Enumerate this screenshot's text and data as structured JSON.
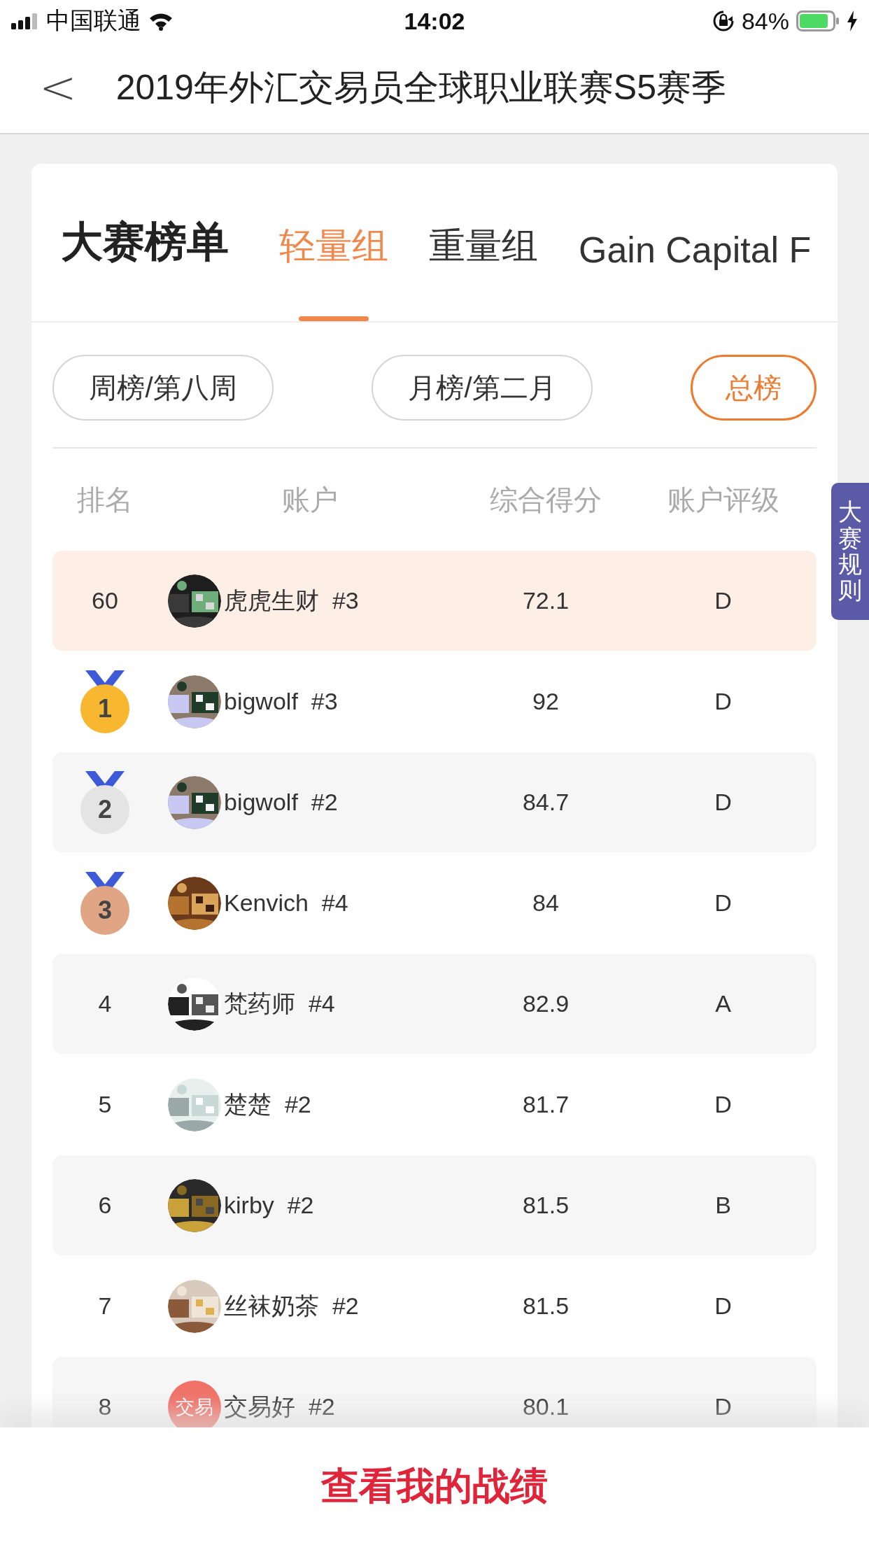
{
  "status_bar": {
    "carrier": "中国联通",
    "time": "14:02",
    "battery": "84%"
  },
  "nav": {
    "back": "<",
    "title": "2019年外汇交易员全球职业联赛S5赛季"
  },
  "board": {
    "title": "大赛榜单",
    "tabs": [
      {
        "label": "轻量组",
        "selected": true
      },
      {
        "label": "重量组",
        "selected": false
      },
      {
        "label": "Gain Capital F",
        "selected": false
      }
    ],
    "filters": [
      {
        "label": "周榜/第八周",
        "selected": false
      },
      {
        "label": "月榜/第二月",
        "selected": false
      },
      {
        "label": "总榜",
        "selected": true
      }
    ],
    "columns": [
      "排名",
      "账户",
      "综合得分",
      "账户评级"
    ],
    "rows": [
      {
        "kind": "number",
        "rank": "60",
        "name": "虎虎生财",
        "tag": "#3",
        "score": "72.1",
        "grade": "D",
        "mine": true
      },
      {
        "kind": "medal",
        "rank": "1",
        "color": "#f7b731",
        "name": "bigwolf",
        "tag": "#3",
        "score": "92",
        "grade": "D",
        "mine": false
      },
      {
        "kind": "medal",
        "rank": "2",
        "color": "#e4e4e4",
        "name": "bigwolf",
        "tag": "#2",
        "score": "84.7",
        "grade": "D",
        "mine": false
      },
      {
        "kind": "medal",
        "rank": "3",
        "color": "#dfa585",
        "name": "Kenvich",
        "tag": "#4",
        "score": "84",
        "grade": "D",
        "mine": false
      },
      {
        "kind": "number",
        "rank": "4",
        "name": "梵药师",
        "tag": "#4",
        "score": "82.9",
        "grade": "A",
        "mine": false
      },
      {
        "kind": "number",
        "rank": "5",
        "name": "楚楚",
        "tag": "#2",
        "score": "81.7",
        "grade": "D",
        "mine": false
      },
      {
        "kind": "number",
        "rank": "6",
        "name": "kirby",
        "tag": "#2",
        "score": "81.5",
        "grade": "B",
        "mine": false
      },
      {
        "kind": "number",
        "rank": "7",
        "name": "丝袜奶茶",
        "tag": "#2",
        "score": "81.5",
        "grade": "D",
        "mine": false
      },
      {
        "kind": "number",
        "rank": "8",
        "avatar": {
          "kind": "text",
          "text": "交易"
        },
        "name": "交易好",
        "tag": "#2",
        "score": "80.1",
        "grade": "D",
        "mine": false
      }
    ]
  },
  "rules_tab": "大赛规则",
  "bottom_button": "查看我的战绩"
}
